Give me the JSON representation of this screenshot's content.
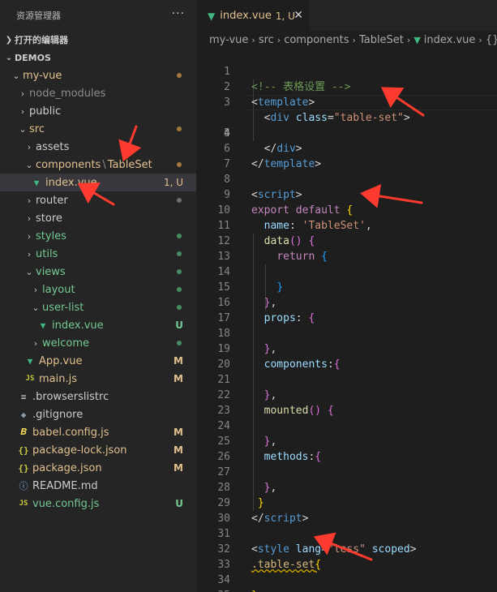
{
  "sidebar": {
    "title": "资源管理器",
    "more": "···",
    "open_editors": "打开的编辑器",
    "project": "DEMOS",
    "tree": [
      {
        "label": "my-vue",
        "status": "mod"
      },
      {
        "label": "node_modules"
      },
      {
        "label": "public"
      },
      {
        "label": "src",
        "status": "mod"
      },
      {
        "label": "assets"
      },
      {
        "label": "components",
        "sub": "TableSet",
        "status": "mod"
      },
      {
        "label": "index.vue",
        "badge": "1, U"
      },
      {
        "label": "router"
      },
      {
        "label": "store"
      },
      {
        "label": "styles",
        "status": "unt"
      },
      {
        "label": "utils",
        "status": "unt"
      },
      {
        "label": "views",
        "status": "unt"
      },
      {
        "label": "layout",
        "status": "unt"
      },
      {
        "label": "user-list",
        "status": "unt"
      },
      {
        "label": "index.vue",
        "badge": "U"
      },
      {
        "label": "welcome",
        "status": "unt"
      },
      {
        "label": "App.vue",
        "badge": "M"
      },
      {
        "label": "main.js",
        "badge": "M"
      },
      {
        "label": ".browserslistrc"
      },
      {
        "label": ".gitignore"
      },
      {
        "label": "babel.config.js",
        "badge": "M"
      },
      {
        "label": "package-lock.json",
        "badge": "M"
      },
      {
        "label": "package.json",
        "badge": "M"
      },
      {
        "label": "README.md"
      },
      {
        "label": "vue.config.js",
        "badge": "U"
      }
    ],
    "components_sep": "\\"
  },
  "editor": {
    "tab": {
      "name": "index.vue",
      "badge": "1, U",
      "close": "✕"
    },
    "breadcrumbs": [
      "my-vue",
      "src",
      "components",
      "TableSet",
      "index.vue",
      "{} \""
    ],
    "line_numbers": [
      "1",
      "2",
      "3",
      "4",
      "5",
      "6",
      "7",
      "8",
      "9",
      "10",
      "11",
      "12",
      "13",
      "14",
      "15",
      "16",
      "17",
      "18",
      "19",
      "20",
      "21",
      "22",
      "23",
      "24",
      "25",
      "26",
      "27",
      "28",
      "29",
      "30",
      "31",
      "32",
      "33",
      "34",
      "35"
    ]
  },
  "code": {
    "l1": "<!-- 表格设置 -->",
    "tpl_open": "template",
    "div_tag": "div",
    "attr_class": "class",
    "str_table_set": "\"table-set\"",
    "script_tag": "script",
    "export": "export",
    "default": "default",
    "name_key": "name",
    "name_val": "'TableSet'",
    "data_fn": "data",
    "return_kw": "return",
    "props_key": "props",
    "components_key": "components",
    "mounted_fn": "mounted",
    "methods_key": "methods",
    "style_tag": "style",
    "lang_attr": "lang",
    "less_val": "\"less\"",
    "scoped_attr": "scoped",
    "selector": ".table-set"
  },
  "colors": {
    "accent_vue": "#41b883",
    "modified": "#e2c08d",
    "untracked": "#73c991",
    "arrow": "#ff3b2f"
  }
}
